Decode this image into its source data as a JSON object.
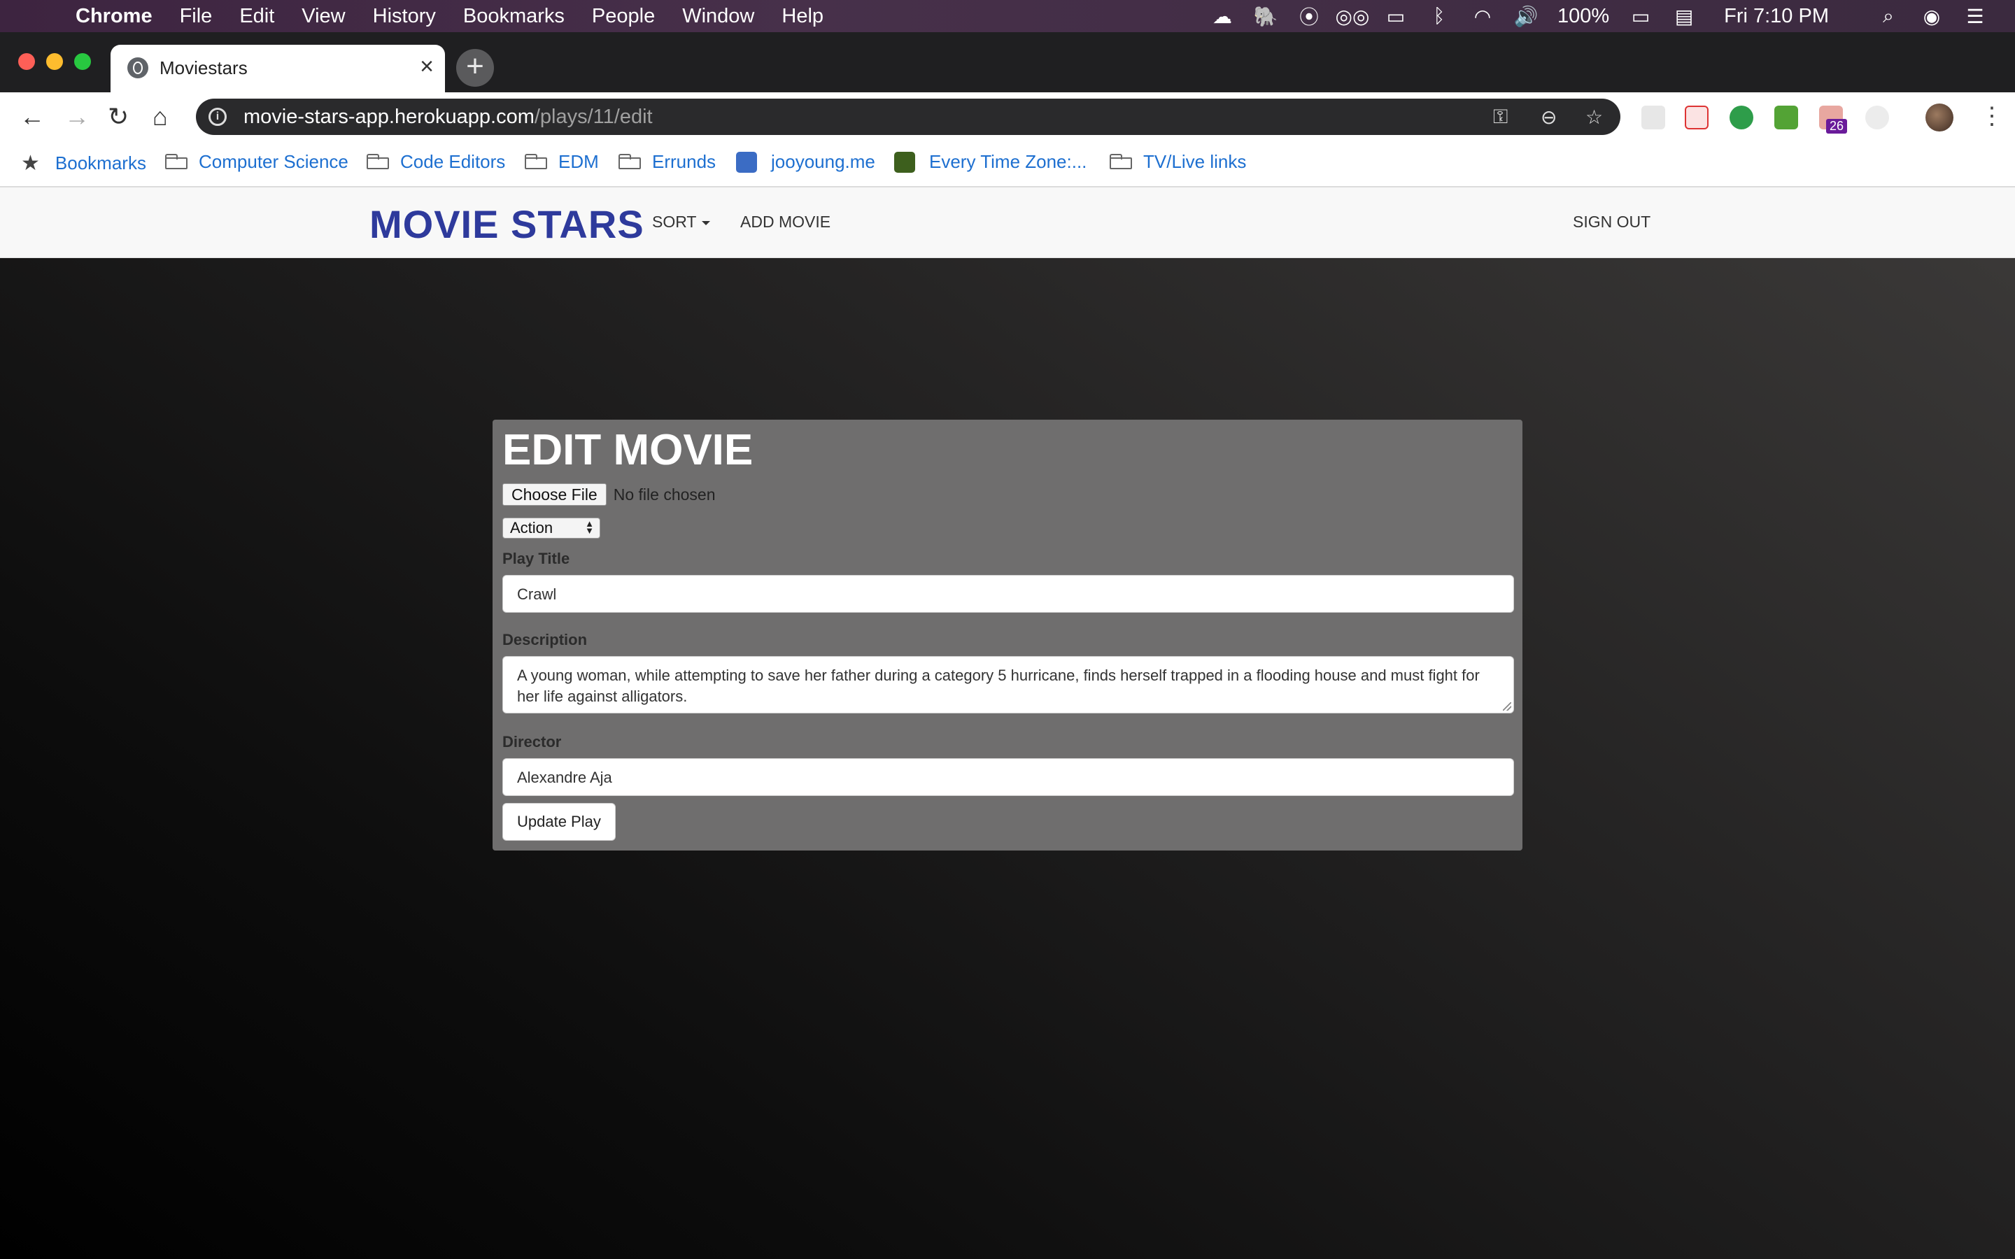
{
  "menubar": {
    "app": "Chrome",
    "items": [
      "File",
      "Edit",
      "View",
      "History",
      "Bookmarks",
      "People",
      "Window",
      "Help"
    ],
    "battery": "100%",
    "clock": "Fri 7:10 PM"
  },
  "tab": {
    "title": "Moviestars",
    "close": "×",
    "new_tab": "+"
  },
  "address_bar": {
    "host": "movie-stars-app.herokuapp.com",
    "path": "/plays/11/edit"
  },
  "extensions": {
    "badge_count": "26"
  },
  "bookmarks": {
    "items": [
      "Bookmarks",
      "Computer Science",
      "Code Editors",
      "EDM",
      "Errunds",
      "jooyoung.me",
      "Every Time Zone:...",
      "TV/Live links"
    ]
  },
  "navbar": {
    "brand": "MOVIE STARS",
    "sort": "SORT",
    "add_movie": "ADD MOVIE",
    "sign_out": "SIGN OUT"
  },
  "form": {
    "heading": "EDIT MOVIE",
    "file_button": "Choose File",
    "file_status": "No file chosen",
    "genre": "Action",
    "title_label": "Play Title",
    "title_value": "Crawl",
    "description_label": "Description",
    "description_value": "A young woman, while attempting to save her father during a category 5 hurricane, finds herself trapped in a flooding house and must fight for her life against alligators.",
    "director_label": "Director",
    "director_value": "Alexandre Aja",
    "submit": "Update Play"
  }
}
